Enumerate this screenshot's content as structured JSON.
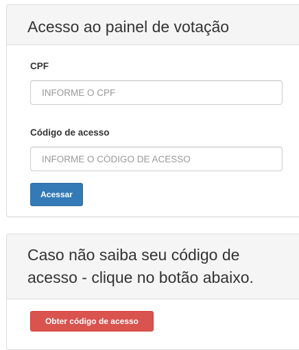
{
  "login_panel": {
    "title": "Acesso ao painel de votação",
    "cpf_label": "CPF",
    "cpf_placeholder": "INFORME O CPF",
    "cpf_value": "",
    "code_label": "Código de acesso",
    "code_placeholder": "INFORME O CÓDIGO DE ACESSO",
    "code_value": "",
    "submit_label": "Acessar"
  },
  "code_panel": {
    "title_line1": "Caso não saiba seu código de",
    "title_line2": "acesso - clique no botão abaixo.",
    "button_label": "Obter código de acesso"
  },
  "colors": {
    "primary": "#337ab7",
    "danger": "#d9534f",
    "heading_bg": "#f5f5f5",
    "border": "#dddddd"
  }
}
